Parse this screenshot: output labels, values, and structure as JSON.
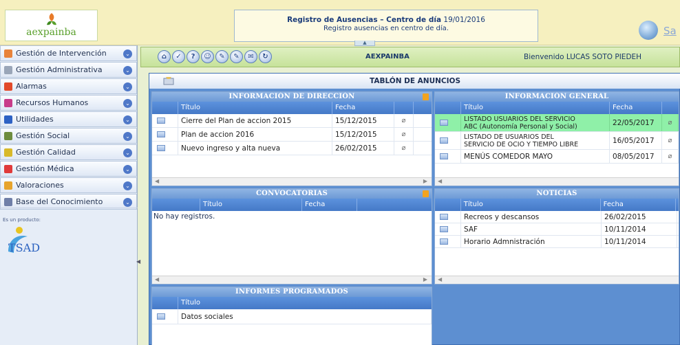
{
  "header": {
    "logo_text": "aexpainba",
    "title_bold": "Registro de Ausencias – Centro de día",
    "title_date": "19/01/2016",
    "subtitle": "Registro ausencias en centro de día.",
    "exit_label": "Sa"
  },
  "sidebar": {
    "items": [
      {
        "label": "Gestión de Intervención",
        "icon_color": "#e8833a"
      },
      {
        "label": "Gestión Administrativa",
        "icon_color": "#9aa6b8"
      },
      {
        "label": "Alarmas",
        "icon_color": "#e24a2a"
      },
      {
        "label": "Recursos Humanos",
        "icon_color": "#c83c8a"
      },
      {
        "label": "Utilidades",
        "icon_color": "#2e62c4"
      },
      {
        "label": "Gestión Social",
        "icon_color": "#6d8c3e"
      },
      {
        "label": "Gestión Calidad",
        "icon_color": "#d8b92a"
      },
      {
        "label": "Gestión Médica",
        "icon_color": "#e03a3a"
      },
      {
        "label": "Valoraciones",
        "icon_color": "#e7a42c"
      },
      {
        "label": "Base del Conocimiento",
        "icon_color": "#6f7fa8"
      }
    ],
    "product_label": "Es un producto:",
    "product_name": "TSAD"
  },
  "toolbar": {
    "icons": [
      "home-icon",
      "back-icon",
      "help-icon",
      "user-icon",
      "edit-icon",
      "edit-alt-icon",
      "mail-icon",
      "refresh-icon"
    ],
    "icon_glyphs": [
      "⌂",
      "✓",
      "?",
      "☺",
      "✎",
      "✎",
      "✉",
      "↻"
    ],
    "org": "AEXPAINBA",
    "welcome": "Bienvenido  LUCAS SOTO PIEDEH"
  },
  "board": {
    "title": "TABLÓN DE ANUNCIOS",
    "direccion": {
      "title": "INFORMACIÓN DE DIRECCIÓN",
      "columns": [
        "Título",
        "Fecha"
      ],
      "rows": [
        {
          "title": "Cierre del Plan de accion 2015",
          "date": "15/12/2015"
        },
        {
          "title": "Plan de accion 2016",
          "date": "15/12/2015"
        },
        {
          "title": "Nuevo ingreso y alta nueva",
          "date": "26/02/2015"
        }
      ]
    },
    "general": {
      "title": "INFORMACIÓN GENERAL",
      "columns": [
        "Título",
        "Fecha"
      ],
      "rows": [
        {
          "title_line1": "LISTADO USUARIOS DEL SERVICIO",
          "title_line2": "ABC (Autonomía Personal y Social)",
          "date": "22/05/2017",
          "selected": true
        },
        {
          "title_line1": "LISTADO DE USUARIOS DEL",
          "title_line2": "SERVICIO DE OCIO Y TIEMPO LIBRE",
          "date": "16/05/2017",
          "selected": false
        },
        {
          "title_line1": "MENÚS COMEDOR MAYO",
          "title_line2": "",
          "date": "08/05/2017",
          "selected": false
        }
      ]
    },
    "convocatorias": {
      "title": "CONVOCATORIAS",
      "columns": [
        "Título",
        "Fecha"
      ],
      "empty": "No hay registros."
    },
    "noticias": {
      "title": "NOTICIAS",
      "columns": [
        "Título",
        "Fecha"
      ],
      "rows": [
        {
          "title": "Recreos y descansos",
          "date": "26/02/2015"
        },
        {
          "title": "SAF",
          "date": "10/11/2014"
        },
        {
          "title": "Horario Admnistración",
          "date": "10/11/2014"
        }
      ]
    },
    "informes": {
      "title": "INFORMES PROGRAMADOS",
      "columns": [
        "Título"
      ],
      "rows": [
        {
          "title": "Datos sociales"
        }
      ]
    }
  }
}
